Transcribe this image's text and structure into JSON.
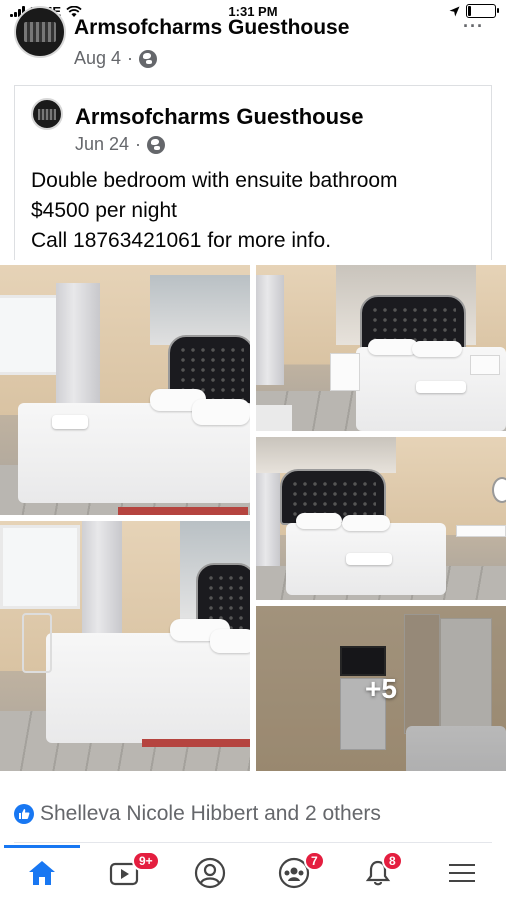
{
  "status_bar": {
    "carrier": "LIME",
    "time": "1:31 PM"
  },
  "outer_post": {
    "page_name": "Armsofcharms Guesthouse",
    "date": "Aug 4",
    "separator": "·",
    "more": "···"
  },
  "shared_post": {
    "page_name": "Armsofcharms Guesthouse",
    "date": "Jun 24",
    "separator": "·",
    "text_lines": [
      "Double bedroom with ensuite bathroom",
      "$4500 per night",
      "Call 18763421061 for more info."
    ]
  },
  "photos": {
    "more_count": "+5"
  },
  "reactions": {
    "summary": "Shelleva Nicole Hibbert and 2 others"
  },
  "nav": {
    "video_badge": "9+",
    "groups_badge": "7",
    "notifications_badge": "8"
  },
  "colors": {
    "facebook_blue": "#1877f2",
    "badge_red": "#e41e3f",
    "secondary_text": "#65676b"
  }
}
